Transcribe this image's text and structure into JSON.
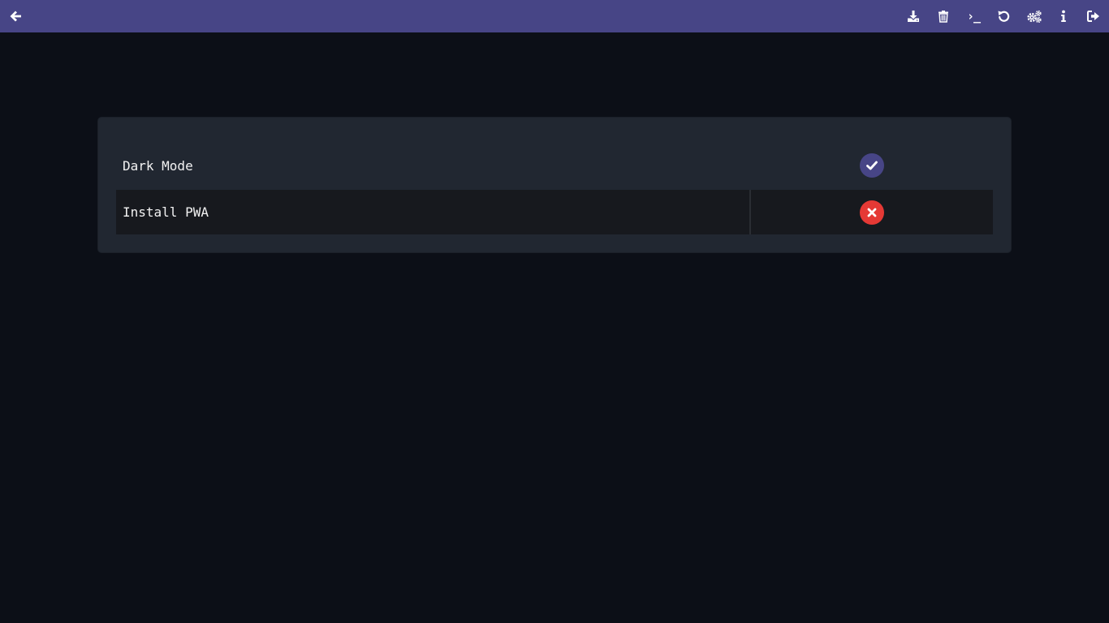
{
  "colors": {
    "header_bg": "#474586",
    "page_bg": "#0c0f17",
    "panel_bg": "#212731",
    "row_alt_bg": "#17191e",
    "enabled": "#474586",
    "disabled": "#e53935"
  },
  "header": {
    "back_icon": "arrow-left-icon",
    "actions": [
      {
        "icon": "download-icon"
      },
      {
        "icon": "trash-icon"
      },
      {
        "icon": "terminal-icon",
        "glyph": "›_"
      },
      {
        "icon": "undo-icon"
      },
      {
        "icon": "cogs-icon"
      },
      {
        "icon": "info-icon"
      },
      {
        "icon": "sign-out-icon"
      }
    ]
  },
  "settings": {
    "rows": [
      {
        "label": "Dark Mode",
        "enabled": true,
        "status_icon": "check-icon"
      },
      {
        "label": "Install PWA",
        "enabled": false,
        "status_icon": "times-icon"
      }
    ]
  }
}
